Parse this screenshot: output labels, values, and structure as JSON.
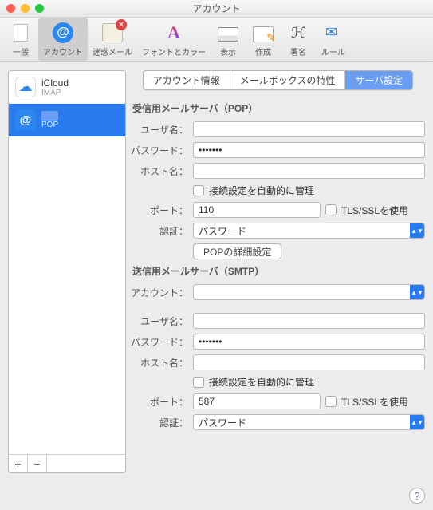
{
  "title": "アカウント",
  "toolbar": [
    {
      "id": "general",
      "label": "一般"
    },
    {
      "id": "accounts",
      "label": "アカウント"
    },
    {
      "id": "junk",
      "label": "迷惑メール"
    },
    {
      "id": "fonts",
      "label": "フォントとカラー"
    },
    {
      "id": "display",
      "label": "表示"
    },
    {
      "id": "compose",
      "label": "作成"
    },
    {
      "id": "signature",
      "label": "署名"
    },
    {
      "id": "rules",
      "label": "ルール"
    }
  ],
  "sidebar": {
    "accounts": [
      {
        "name": "iCloud",
        "sub": "IMAP"
      },
      {
        "name": "████████",
        "sub": "POP"
      }
    ],
    "add": "+",
    "remove": "−"
  },
  "tabs": [
    {
      "label": "アカウント情報"
    },
    {
      "label": "メールボックスの特性"
    },
    {
      "label": "サーバ設定"
    }
  ],
  "pop": {
    "section": "受信用メールサーバ（POP）",
    "user_label": "ユーザ名：",
    "user_value": "",
    "pw_label": "パスワード：",
    "pw_value": "•••••••",
    "host_label": "ホスト名：",
    "host_value": "",
    "auto_label": "接続設定を自動的に管理",
    "port_label": "ポート：",
    "port_value": "110",
    "tls_label": "TLS/SSLを使用",
    "auth_label": "認証：",
    "auth_value": "パスワード",
    "adv_btn": "POPの詳細設定"
  },
  "smtp": {
    "section": "送信用メールサーバ（SMTP）",
    "acct_label": "アカウント：",
    "acct_value": "",
    "user_label": "ユーザ名：",
    "user_value": "",
    "pw_label": "パスワード：",
    "pw_value": "•••••••",
    "host_label": "ホスト名：",
    "host_value": "",
    "auto_label": "接続設定を自動的に管理",
    "port_label": "ポート：",
    "port_value": "587",
    "tls_label": "TLS/SSLを使用",
    "auth_label": "認証：",
    "auth_value": "パスワード"
  },
  "help": "?"
}
